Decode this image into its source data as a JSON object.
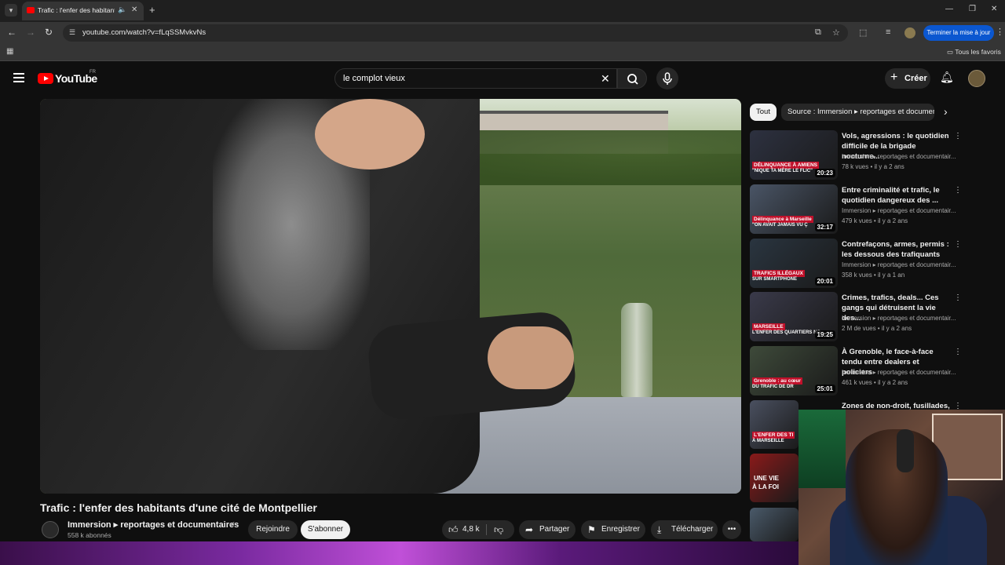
{
  "browser": {
    "tab_title": "Trafic : l'enfer des habitants d'une cité de Montpellier",
    "url": "youtube.com/watch?v=fLqSSMvkvNs",
    "update_button": "Terminer la mise à jour",
    "bookmarks_folder": "Tous les favoris"
  },
  "youtube": {
    "logo_text": "YouTube",
    "country_code": "FR",
    "search_value": "le complot vieux",
    "create_label": "Créer"
  },
  "video": {
    "title": "Trafic : l'enfer des habitants d'une cité de Montpellier",
    "channel_name": "Immersion ▸ reportages et documentaires",
    "subscribers": "558 k abonnés",
    "join_label": "Rejoindre",
    "subscribe_label": "S'abonner",
    "like_count": "4,8 k",
    "share_label": "Partager",
    "save_label": "Enregistrer",
    "download_label": "Télécharger"
  },
  "sidebar": {
    "chips": [
      "Tout",
      "Source : Immersion ▸ reportages et documentaires"
    ],
    "recommendations": [
      {
        "title": "Vols, agressions : le quotidien difficile de la brigade nocturne...",
        "channel": "Immersion ▸ reportages et documentair...",
        "meta": "78 k vues • il y a 2 ans",
        "duration": "20:23",
        "thumb_tag": "DÉLINQUANCE À AMIENS",
        "thumb_sub": "\"NIQUE TA MÈRE LE FLIC\"",
        "thumb_color": "#2d3140"
      },
      {
        "title": "Entre criminalité et trafic, le quotidien dangereux des ...",
        "channel": "Immersion ▸ reportages et documentair...",
        "meta": "479 k vues • il y a 2 ans",
        "duration": "32:17",
        "thumb_tag": "Délinquance à Marseille",
        "thumb_sub": "\"ON AVAIT JAMAIS VU Ç",
        "thumb_color": "#4a5566"
      },
      {
        "title": "Contrefaçons, armes, permis : les dessous des trafiquants",
        "channel": "Immersion ▸ reportages et documentair...",
        "meta": "358 k vues • il y a 1 an",
        "duration": "20:01",
        "thumb_tag": "TRAFICS ILLÉGAUX",
        "thumb_sub": "SUR SMARTPHONE",
        "thumb_color": "#2a3540"
      },
      {
        "title": "Crimes, trafics, deals... Ces gangs qui détruisent la vie des...",
        "channel": "Immersion ▸ reportages et documentair...",
        "meta": "2 M de vues • il y a 2 ans",
        "duration": "19:25",
        "thumb_tag": "MARSEILLE",
        "thumb_sub": "L'ENFER DES QUARTIERS NO",
        "thumb_color": "#3a3a4a"
      },
      {
        "title": "À Grenoble, le face-à-face tendu entre dealers et policiers",
        "channel": "Immersion ▸ reportages et documentair...",
        "meta": "461 k vues • il y a 2 ans",
        "duration": "25:01",
        "thumb_tag": "Grenoble : au cœur",
        "thumb_sub": "DU TRAFIC DE DR",
        "thumb_color": "#3e4a3a"
      },
      {
        "title": "Zones de non-droit, fusillades,",
        "channel": "",
        "meta": "",
        "duration": "",
        "thumb_tag": "L'ENFER DES TI",
        "thumb_sub": "À MARSEILLE",
        "thumb_color": "#4a5060"
      }
    ],
    "partial_thumbs": [
      {
        "tag": "UNE VIE",
        "sub": "À LA FOI",
        "color": "#8a1a1a"
      },
      {
        "tag": "",
        "sub": "",
        "color": "#4a5a6a"
      }
    ]
  },
  "colors": {
    "accent_red": "#ff0000",
    "update_blue": "#0b57d0"
  }
}
